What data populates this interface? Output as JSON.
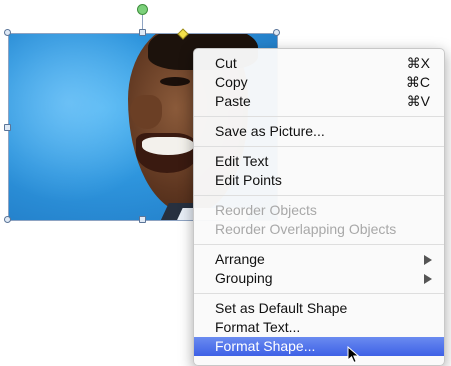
{
  "menu": {
    "groups": [
      [
        {
          "label": "Cut",
          "shortcut": "⌘X"
        },
        {
          "label": "Copy",
          "shortcut": "⌘C"
        },
        {
          "label": "Paste",
          "shortcut": "⌘V"
        }
      ],
      [
        {
          "label": "Save as Picture..."
        }
      ],
      [
        {
          "label": "Edit Text"
        },
        {
          "label": "Edit Points"
        }
      ],
      [
        {
          "label": "Reorder Objects",
          "disabled": true
        },
        {
          "label": "Reorder Overlapping Objects",
          "disabled": true
        }
      ],
      [
        {
          "label": "Arrange",
          "submenu": true
        },
        {
          "label": "Grouping",
          "submenu": true
        }
      ],
      [
        {
          "label": "Set as Default Shape"
        },
        {
          "label": "Format Text..."
        },
        {
          "label": "Format Shape...",
          "highlighted": true
        }
      ]
    ]
  },
  "colors": {
    "highlight": "#3e61e6",
    "disabled_text": "#a8a8a8",
    "rotation_handle": "#7bd07a",
    "adjust_handle": "#f3e04a"
  },
  "icons": {
    "submenu": "triangle-right-icon",
    "cursor": "mouse-pointer-icon"
  }
}
